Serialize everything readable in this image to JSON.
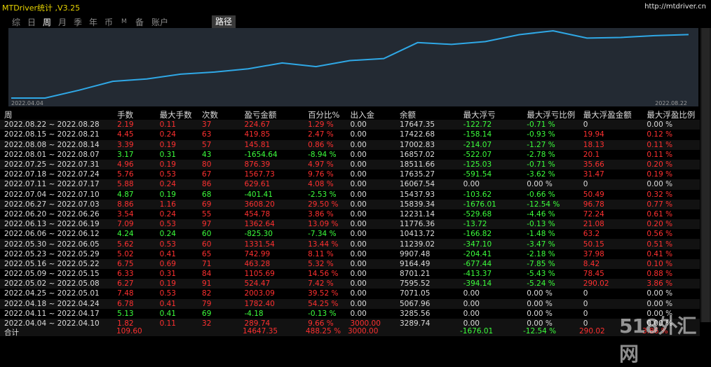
{
  "app": {
    "title": "MTDriver统计 ,V3.25",
    "url": "http://mtdriver.cn"
  },
  "tabs": [
    "综",
    "日",
    "周",
    "月",
    "季",
    "年",
    "币",
    "M",
    "备",
    "账户"
  ],
  "active_tab": "周",
  "route_tab": "路径",
  "chart": {
    "start_date": "2022.04.04",
    "end_date": "2022.08.22",
    "line_color": "#2fa8e6",
    "balances": [
      3289.74,
      3285.56,
      5067.96,
      7071.05,
      7595.52,
      8701.21,
      9164.49,
      9907.48,
      11239.02,
      10413.72,
      11776.36,
      12231.14,
      15839.34,
      15437.93,
      16067.54,
      17635.27,
      18511.66,
      16857.02,
      17002.83,
      17422.68,
      17647.35
    ]
  },
  "table": {
    "headers": [
      "周",
      "手数",
      "最大手数",
      "次数",
      "盈亏金额",
      "百分比%",
      "出入金",
      "余额",
      "最大浮亏",
      "最大浮亏比例",
      "最大浮盈金额",
      "最大浮盈比例"
    ],
    "rows": [
      [
        "2022.08.22 ~ 2022.08.28",
        "2.19",
        "0.11",
        "37",
        "224.67",
        "1.29 %",
        "0.00",
        "17647.35",
        "-122.72",
        "-0.71 %",
        "0",
        "0.00 %"
      ],
      [
        "2022.08.15 ~ 2022.08.21",
        "4.45",
        "0.24",
        "63",
        "419.85",
        "2.47 %",
        "0.00",
        "17422.68",
        "-158.14",
        "-0.93 %",
        "19.94",
        "0.12 %"
      ],
      [
        "2022.08.08 ~ 2022.08.14",
        "3.39",
        "0.19",
        "57",
        "145.81",
        "0.86 %",
        "0.00",
        "17002.83",
        "-214.07",
        "-1.27 %",
        "18.13",
        "0.11 %"
      ],
      [
        "2022.08.01 ~ 2022.08.07",
        "3.17",
        "0.31",
        "43",
        "-1654.64",
        "-8.94 %",
        "0.00",
        "16857.02",
        "-522.07",
        "-2.78 %",
        "20.1",
        "0.11 %"
      ],
      [
        "2022.07.25 ~ 2022.07.31",
        "4.96",
        "0.19",
        "80",
        "876.39",
        "4.97 %",
        "0.00",
        "18511.66",
        "-125.03",
        "-0.71 %",
        "35.66",
        "0.20 %"
      ],
      [
        "2022.07.18 ~ 2022.07.24",
        "5.76",
        "0.53",
        "67",
        "1567.73",
        "9.76 %",
        "0.00",
        "17635.27",
        "-591.54",
        "-3.62 %",
        "31.47",
        "0.19 %"
      ],
      [
        "2022.07.11 ~ 2022.07.17",
        "5.88",
        "0.24",
        "86",
        "629.61",
        "4.08 %",
        "0.00",
        "16067.54",
        "0.00",
        "0.00 %",
        "0",
        "0.00 %"
      ],
      [
        "2022.07.04 ~ 2022.07.10",
        "4.87",
        "0.19",
        "68",
        "-401.41",
        "-2.53 %",
        "0.00",
        "15437.93",
        "-103.62",
        "-0.66 %",
        "50.49",
        "0.32 %"
      ],
      [
        "2022.06.27 ~ 2022.07.03",
        "8.86",
        "1.16",
        "69",
        "3608.20",
        "29.50 %",
        "0.00",
        "15839.34",
        "-1676.01",
        "-12.54 %",
        "96.78",
        "0.77 %"
      ],
      [
        "2022.06.20 ~ 2022.06.26",
        "3.54",
        "0.24",
        "55",
        "454.78",
        "3.86 %",
        "0.00",
        "12231.14",
        "-529.68",
        "-4.46 %",
        "72.24",
        "0.61 %"
      ],
      [
        "2022.06.13 ~ 2022.06.19",
        "7.09",
        "0.53",
        "97",
        "1362.64",
        "13.09 %",
        "0.00",
        "11776.36",
        "-13.72",
        "-0.13 %",
        "21.08",
        "0.20 %"
      ],
      [
        "2022.06.06 ~ 2022.06.12",
        "4.24",
        "0.24",
        "60",
        "-825.30",
        "-7.34 %",
        "0.00",
        "10413.72",
        "-166.82",
        "-1.48 %",
        "63.2",
        "0.56 %"
      ],
      [
        "2022.05.30 ~ 2022.06.05",
        "5.62",
        "0.53",
        "60",
        "1331.54",
        "13.44 %",
        "0.00",
        "11239.02",
        "-347.10",
        "-3.47 %",
        "50.15",
        "0.51 %"
      ],
      [
        "2022.05.23 ~ 2022.05.29",
        "5.02",
        "0.41",
        "65",
        "742.99",
        "8.11 %",
        "0.00",
        "9907.48",
        "-204.41",
        "-2.18 %",
        "37.98",
        "0.41 %"
      ],
      [
        "2022.05.16 ~ 2022.05.22",
        "6.75",
        "0.69",
        "71",
        "463.28",
        "5.32 %",
        "0.00",
        "9164.49",
        "-677.44",
        "-7.85 %",
        "8.42",
        "0.10 %"
      ],
      [
        "2022.05.09 ~ 2022.05.15",
        "6.33",
        "0.31",
        "84",
        "1105.69",
        "14.56 %",
        "0.00",
        "8701.21",
        "-413.37",
        "-5.43 %",
        "78.45",
        "0.88 %"
      ],
      [
        "2022.05.02 ~ 2022.05.08",
        "6.27",
        "0.19",
        "91",
        "524.47",
        "7.42 %",
        "0.00",
        "7595.52",
        "-394.14",
        "-5.24 %",
        "290.02",
        "3.86 %"
      ],
      [
        "2022.04.25 ~ 2022.05.01",
        "7.48",
        "0.53",
        "82",
        "2003.09",
        "39.52 %",
        "0.00",
        "7071.05",
        "0.00",
        "0.00 %",
        "0",
        "0.00 %"
      ],
      [
        "2022.04.18 ~ 2022.04.24",
        "6.78",
        "0.41",
        "79",
        "1782.40",
        "54.25 %",
        "0.00",
        "5067.96",
        "0.00",
        "0.00 %",
        "0",
        "0.00 %"
      ],
      [
        "2022.04.11 ~ 2022.04.17",
        "5.13",
        "0.41",
        "69",
        "-4.18",
        "-0.13 %",
        "0.00",
        "3285.56",
        "0.00",
        "0.00 %",
        "0",
        "0.00 %"
      ],
      [
        "2022.04.04 ~ 2022.04.10",
        "1.82",
        "0.11",
        "32",
        "289.74",
        "9.66 %",
        "3000.00",
        "3289.74",
        "0.00",
        "0.00 %",
        "0",
        "0.00 %"
      ]
    ],
    "total": {
      "label": "合计",
      "lots": "109.60",
      "pnl": "14647.35",
      "pct": "488.25 %",
      "deposit": "3000.00",
      "max_dd": "-1676.01",
      "max_dd_pct": "-12.54 %",
      "max_profit": "290.02",
      "max_profit_pct": "3.86 %"
    }
  },
  "watermark": "518外汇网"
}
